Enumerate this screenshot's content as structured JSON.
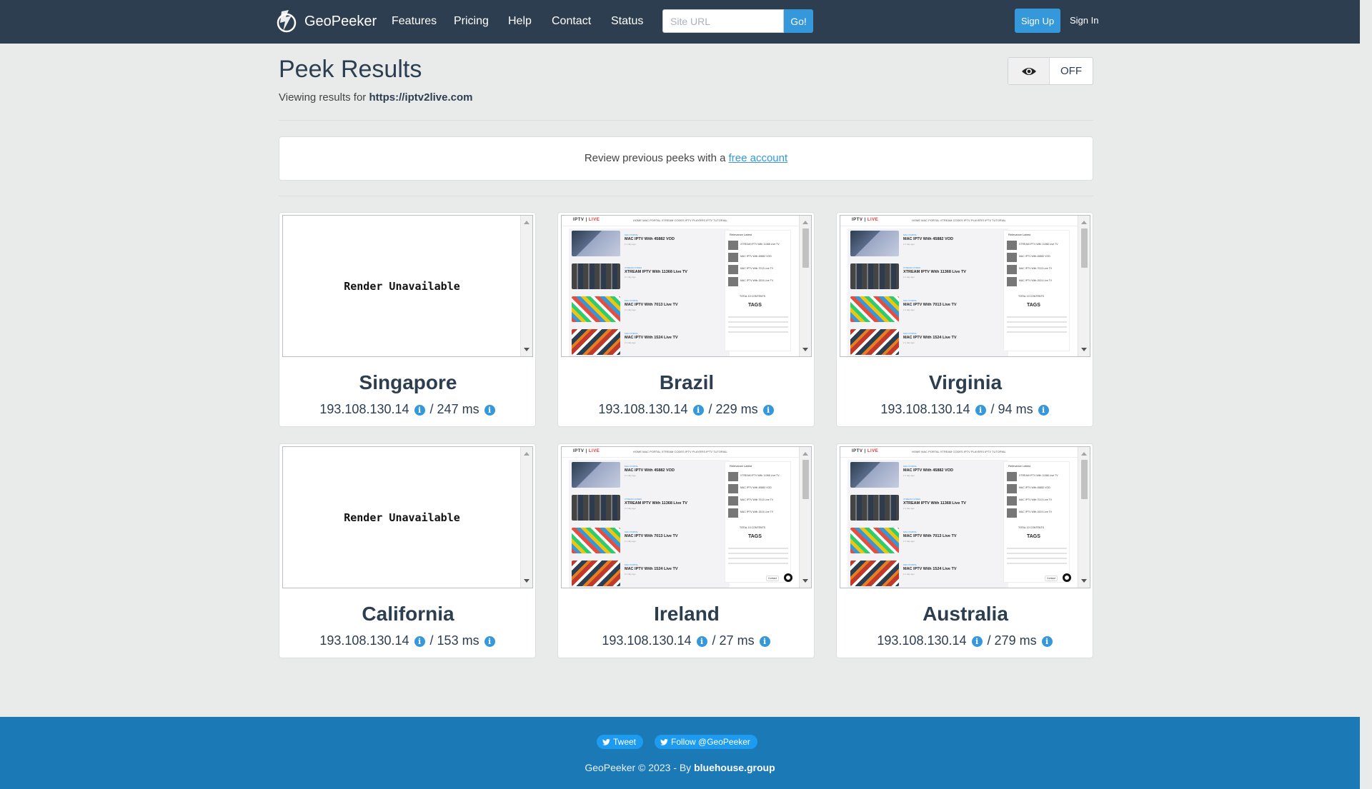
{
  "navbar": {
    "brand": "GeoPeeker",
    "links": [
      "Features",
      "Pricing",
      "Help",
      "Contact",
      "Status"
    ],
    "url_placeholder": "Site URL",
    "go_label": "Go!",
    "signup_label": "Sign Up",
    "signin_label": "Sign In"
  },
  "header": {
    "title": "Peek Results",
    "subtitle_prefix": "Viewing results for ",
    "url": "https://iptv2live.com",
    "toggle_state": "OFF"
  },
  "notice": {
    "text": "Review previous peeks with a ",
    "link": "free account"
  },
  "results": [
    {
      "location": "Singapore",
      "ip": "193.108.130.14",
      "latency": "247 ms",
      "render": "unavailable"
    },
    {
      "location": "Brazil",
      "ip": "193.108.130.14",
      "latency": "229 ms",
      "render": "screenshot"
    },
    {
      "location": "Virginia",
      "ip": "193.108.130.14",
      "latency": "94 ms",
      "render": "screenshot"
    },
    {
      "location": "California",
      "ip": "193.108.130.14",
      "latency": "153 ms",
      "render": "unavailable"
    },
    {
      "location": "Ireland",
      "ip": "193.108.130.14",
      "latency": "27 ms",
      "render": "screenshot"
    },
    {
      "location": "Australia",
      "ip": "193.108.130.14",
      "latency": "279 ms",
      "render": "screenshot"
    }
  ],
  "render_unavailable_text": "Render Unavailable",
  "preview": {
    "logo_a": "IPTV",
    "logo_b": "LIVE",
    "menu": "HOME   MAC PORTAL   XTREAM CODES   IPTV PLAYERS   IPTV TUTORIAL",
    "posts": [
      {
        "tag": "MAC PORTAL",
        "title": "MAC IPTV With 45882 VOD",
        "meta": "2 1 day ago"
      },
      {
        "tag": "XTREAM CODES",
        "title": "XTREAM IPTV With 11368 Live TV",
        "meta": "2 1 day ago"
      },
      {
        "tag": "MAC PORTAL",
        "title": "MAC IPTV With 7013 Live TV",
        "meta": "2 1 day ago"
      },
      {
        "tag": "MAC PORTAL",
        "title": "MAC IPTV With 1524 Live TV",
        "meta": "2 1 day ago"
      }
    ],
    "side_tabs": "Relevance      Latest",
    "side_items": [
      "XTREAM IPTV With 11368 Live TV",
      "MAC IPTV With 45882 VOD",
      "MAC IPTV With 7013 Live TV",
      "MAC IPTV With 1524 Live TV"
    ],
    "side_head": "TOTAL 10 CONTENTS",
    "tags_label": "TAGS",
    "contact_label": "Contact"
  },
  "footer": {
    "tweet_label": "Tweet",
    "follow_label": "Follow @GeoPeeker",
    "copyright_prefix": "GeoPeeker © 2023 - By ",
    "copyright_link": "bluehouse.group"
  },
  "colors": {
    "navbar_bg": "#2c3e50",
    "accent": "#3498db",
    "footer_bg": "#1b79b6",
    "page_bg": "#e9eaea"
  }
}
